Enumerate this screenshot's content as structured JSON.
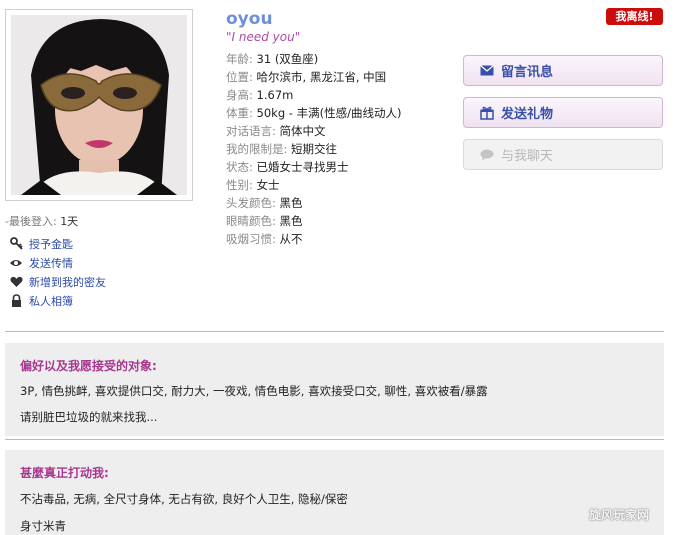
{
  "profile": {
    "username": "oyou",
    "tagline": "\"I need you\"",
    "status_badge": "我离线!",
    "last_login_label": "-最後登入:",
    "last_login_value": "1天"
  },
  "details": [
    {
      "key": "年龄:",
      "value": "31 (双鱼座)"
    },
    {
      "key": "位置:",
      "value": "哈尔滨市, 黑龙江省, 中国"
    },
    {
      "key": "身高:",
      "value": "1.67m"
    },
    {
      "key": "体重:",
      "value": "50kg - 丰满(性感/曲线动人)"
    },
    {
      "key": "对话语言:",
      "value": "简体中文"
    },
    {
      "key": "我的限制是:",
      "value": "短期交往"
    },
    {
      "key": "状态:",
      "value": "已婚女士寻找男士"
    },
    {
      "key": "性别:",
      "value": "女士"
    },
    {
      "key": "头发颜色:",
      "value": "黑色"
    },
    {
      "key": "眼睛颜色:",
      "value": "黑色"
    },
    {
      "key": "吸烟习惯:",
      "value": "从不"
    }
  ],
  "side_actions": [
    {
      "label": "授予金匙",
      "icon": "key-icon"
    },
    {
      "label": "发送传情",
      "icon": "eye-icon"
    },
    {
      "label": "新增到我的密友",
      "icon": "heart-icon"
    },
    {
      "label": "私人相簿",
      "icon": "lock-icon"
    }
  ],
  "buttons": {
    "message": "留言讯息",
    "gift": "发送礼物",
    "chat": "与我聊天"
  },
  "sections": [
    {
      "title": "偏好以及我愿接受的对象:",
      "lines": [
        "3P, 情色挑衅, 喜欢提供口交, 耐力大, 一夜戏, 情色电影, 喜欢接受口交, 聊性, 喜欢被看/暴露",
        "请别脏巴垃圾的就来找我..."
      ]
    },
    {
      "title": "甚麼真正打动我:",
      "lines": [
        "不沾毒品, 无病, 全尺寸身体, 无占有欲, 良好个人卫生, 隐秘/保密",
        "身寸米青"
      ]
    }
  ],
  "watermark": "旋风玩家网",
  "colors": {
    "accent_link": "#2a4aa8",
    "username": "#6f8fd9",
    "section_title": "#a9378f",
    "badge": "#cc0b0b"
  }
}
